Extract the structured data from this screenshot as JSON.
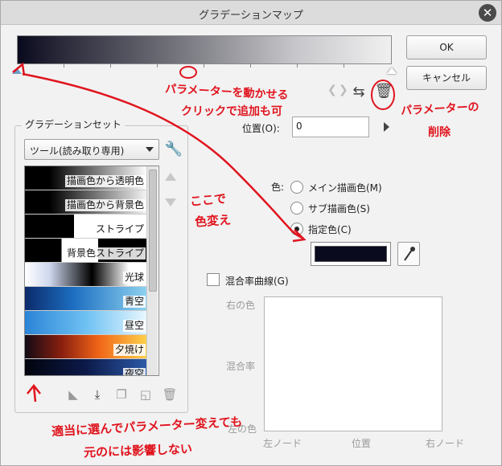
{
  "window": {
    "title": "グラデーションマップ",
    "close_glyph": "✕"
  },
  "buttons": {
    "ok": "OK",
    "cancel": "キャンセル"
  },
  "position": {
    "label": "位置(O):",
    "value": "0"
  },
  "color": {
    "label": "色:",
    "options": [
      "メイン描画色(M)",
      "サブ描画色(S)",
      "指定色(C)"
    ],
    "selected_index": 2,
    "swatch_hex": "#0a0a1e"
  },
  "curve": {
    "checkbox_label": "混合率曲線(G)",
    "y_top": "右の色",
    "y_mid": "混合率",
    "y_bottom": "左の色",
    "x_left": "左ノード",
    "x_mid": "位置",
    "x_right": "右ノード"
  },
  "gradient_set": {
    "group_title": "グラデーションセット",
    "selected_set": "ツール(読み取り専用)",
    "items": [
      "描画色から透明色",
      "描画色から背景色",
      "ストライプ",
      "背景色ストライプ",
      "光球",
      "青空",
      "昼空",
      "夕焼け",
      "夜空"
    ]
  },
  "annotations": {
    "move_hint_1": "パラメーターを動かせる",
    "move_hint_2": "クリックで追加も可",
    "delete_hint_1": "パラメーターの",
    "delete_hint_2": "削除",
    "color_hint_1": "ここで",
    "color_hint_2": "色変え",
    "bottom_hint_1": "適当に選んでパラメーター変えても",
    "bottom_hint_2": "元のには影響しない",
    "color": "#e0141e"
  },
  "icons": {
    "close": "close-icon",
    "prev": "chevron-left-icon",
    "next": "chevron-right-icon",
    "flip": "flip-icon",
    "delete": "trash-icon",
    "settings": "wrench-icon",
    "dropper": "eyedropper-icon"
  }
}
